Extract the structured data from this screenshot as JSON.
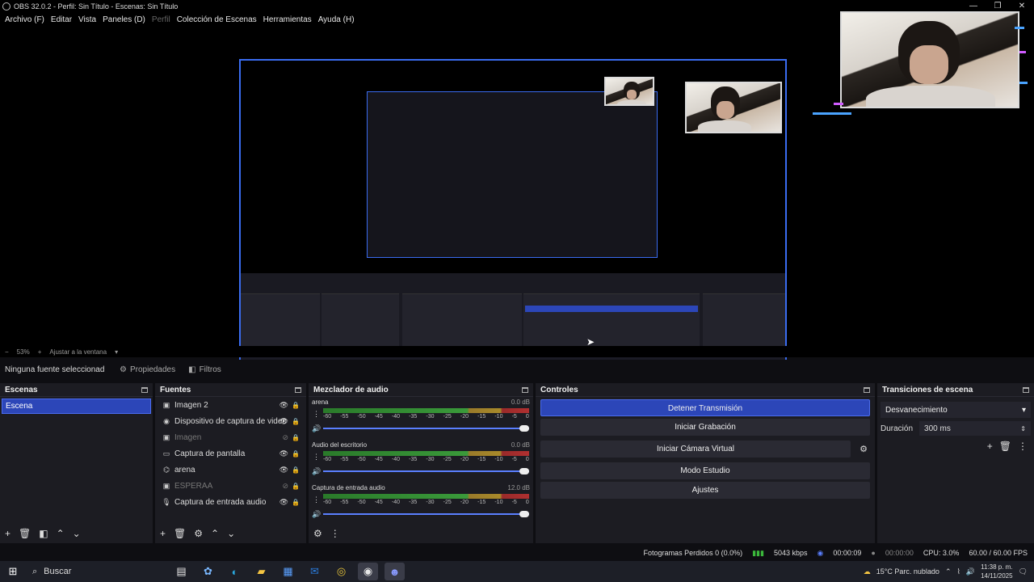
{
  "window": {
    "title": "OBS 32.0.2 - Perfil: Sin Título - Escenas: Sin Título",
    "controls": [
      "—",
      "❐",
      "✕"
    ]
  },
  "menu": [
    {
      "label": "Archivo (F)",
      "enabled": true
    },
    {
      "label": "Editar",
      "enabled": true
    },
    {
      "label": "Vista",
      "enabled": true
    },
    {
      "label": "Paneles (D)",
      "enabled": true
    },
    {
      "label": "Perfil",
      "enabled": false
    },
    {
      "label": "Colección de Escenas",
      "enabled": true
    },
    {
      "label": "Herramientas",
      "enabled": true
    },
    {
      "label": "Ayuda (H)",
      "enabled": true
    }
  ],
  "zoom": {
    "value": "53%",
    "fit_label": "Ajustar a la ventana"
  },
  "source_toolbar": {
    "no_source": "Ninguna fuente seleccionad",
    "properties": "Propiedades",
    "filters": "Filtros"
  },
  "scenes": {
    "title": "Escenas",
    "items": [
      "Escena"
    ]
  },
  "sources": {
    "title": "Fuentes",
    "items": [
      {
        "label": "Imagen 2",
        "icon": "image-icon",
        "visible": true
      },
      {
        "label": "Dispositivo de captura de video",
        "icon": "camera-icon",
        "visible": true
      },
      {
        "label": "Imagen",
        "icon": "image-icon",
        "visible": false
      },
      {
        "label": "Captura de pantalla",
        "icon": "monitor-icon",
        "visible": true
      },
      {
        "label": "arena",
        "icon": "gamepad-icon",
        "visible": true
      },
      {
        "label": "ESPERAA",
        "icon": "image-icon",
        "visible": false
      },
      {
        "label": "Captura de entrada audio",
        "icon": "microphone-icon",
        "visible": true
      }
    ]
  },
  "mixer": {
    "title": "Mezclador de audio",
    "ticks": [
      "-60",
      "-55",
      "-50",
      "-45",
      "-40",
      "-35",
      "-30",
      "-25",
      "-20",
      "-15",
      "-10",
      "-5",
      "0"
    ],
    "channels": [
      {
        "name": "arena",
        "db": "0.0 dB"
      },
      {
        "name": "Audio del escritorio",
        "db": "0.0 dB"
      },
      {
        "name": "Captura de entrada audio",
        "db": "12.0 dB"
      }
    ]
  },
  "controls": {
    "title": "Controles",
    "stop_stream": "Detener Transmisión",
    "start_recording": "Iniciar Grabación",
    "virtual_cam": "Iniciar Cámara Virtual",
    "studio_mode": "Modo Estudio",
    "settings": "Ajustes"
  },
  "transitions": {
    "title": "Transiciones de escena",
    "selected": "Desvanecimiento",
    "duration_label": "Duración",
    "duration_value": "300 ms"
  },
  "status": {
    "dropped": "Fotogramas Perdidos 0 (0.0%)",
    "kbps": "5043 kbps",
    "stream_time": "00:00:09",
    "rec_time": "00:00:00",
    "cpu": "CPU: 3.0%",
    "fps": "60.00 / 60.00 FPS"
  },
  "taskbar": {
    "search": "Buscar",
    "weather": "15°C  Parc. nublado",
    "time": "11:38 p. m.",
    "date": "14/11/2025"
  }
}
